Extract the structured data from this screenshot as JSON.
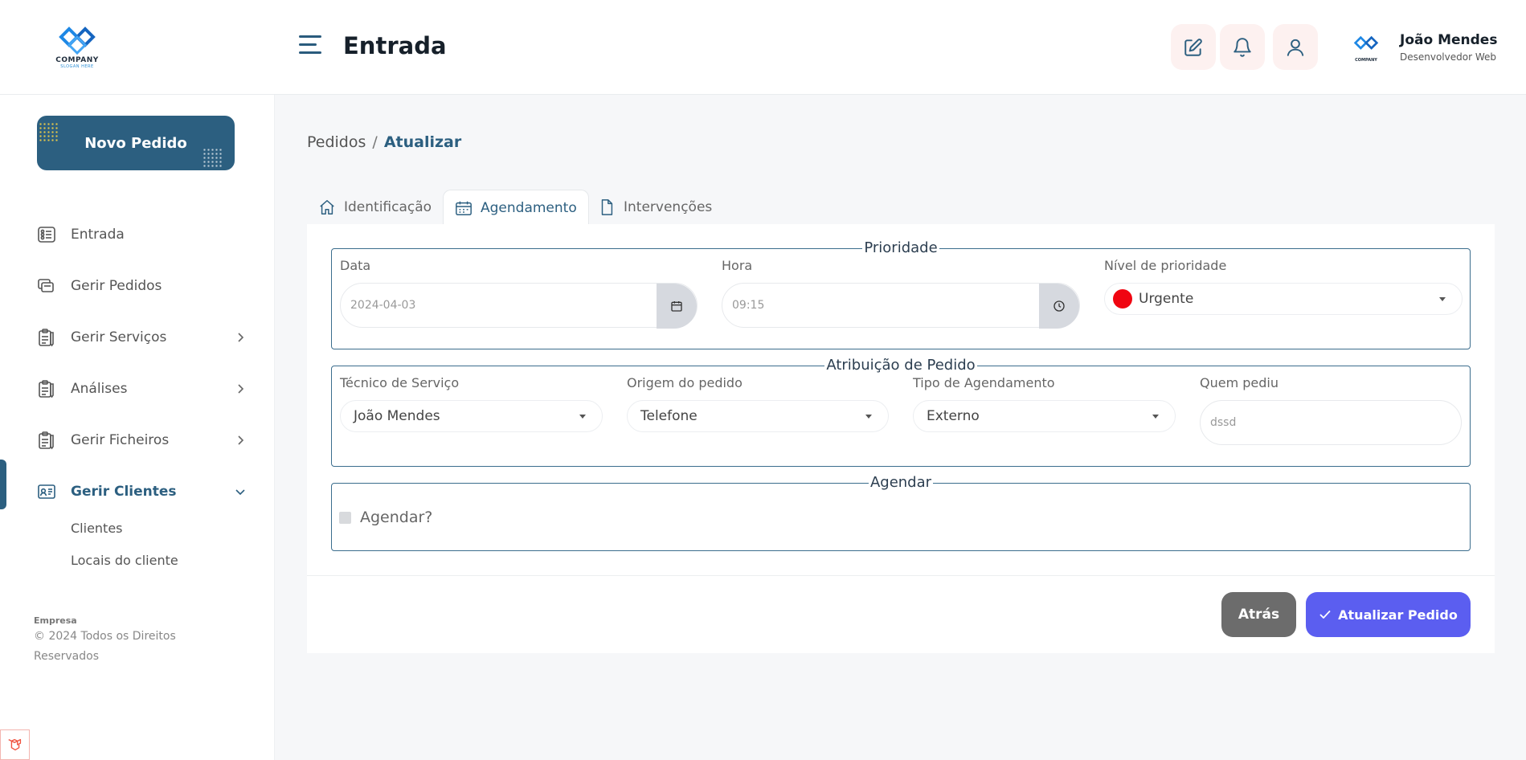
{
  "brand": {
    "name": "COMPANY",
    "slogan": "SLOGAN HERE"
  },
  "header": {
    "title": "Entrada",
    "buttons": [
      {
        "icon": "edit-icon"
      },
      {
        "icon": "bell-icon"
      },
      {
        "icon": "user-icon"
      }
    ],
    "profile": {
      "logo_text": "COMPANY",
      "name": "João Mendes",
      "role": "Desenvolvedor Web"
    }
  },
  "sidebar": {
    "new_order_label": "Novo Pedido",
    "items": [
      {
        "label": "Entrada",
        "icon": "dashboard-icon",
        "has_chevron": false
      },
      {
        "label": "Gerir Pedidos",
        "icon": "stack-icon",
        "has_chevron": false
      },
      {
        "label": "Gerir Serviços",
        "icon": "clipboard-icon",
        "has_chevron": true
      },
      {
        "label": "Análises",
        "icon": "clipboard-icon",
        "has_chevron": true
      },
      {
        "label": "Gerir Ficheiros",
        "icon": "clipboard-icon",
        "has_chevron": true
      },
      {
        "label": "Gerir Clientes",
        "icon": "id-card-icon",
        "has_chevron": true,
        "active": true
      }
    ],
    "subitems": [
      "Clientes",
      "Locais do cliente"
    ],
    "footer_company": "Empresa",
    "footer_copy": "© 2024 Todos os Direitos Reservados"
  },
  "breadcrumb": {
    "parent": "Pedidos",
    "separator": "/",
    "current": "Atualizar"
  },
  "tabs": [
    {
      "label": "Identificação",
      "icon": "home-icon"
    },
    {
      "label": "Agendamento",
      "icon": "calendar-icon",
      "active": true
    },
    {
      "label": "Intervenções",
      "icon": "file-icon"
    }
  ],
  "priority": {
    "legend": "Prioridade",
    "date_label": "Data",
    "date_value": "2024-04-03",
    "time_label": "Hora",
    "time_value": "09:15",
    "level_label": "Nível de prioridade",
    "level_value": "Urgente",
    "level_color": "#f00511"
  },
  "assignment": {
    "legend": "Atribuição de Pedido",
    "technician_label": "Técnico de Serviço",
    "technician_value": "João Mendes",
    "origin_label": "Origem do pedido",
    "origin_value": "Telefone",
    "type_label": "Tipo de Agendamento",
    "type_value": "Externo",
    "requester_label": "Quem pediu",
    "requester_value": "dssd"
  },
  "schedule": {
    "legend": "Agendar",
    "checkbox_label": "Agendar?",
    "checked": false
  },
  "actions": {
    "back_label": "Atrás",
    "update_label": "Atualizar Pedido"
  },
  "colors": {
    "primary": "#2c5f80",
    "accent": "#5b5ef0",
    "back": "#6c6c6c",
    "urgent": "#f00511"
  }
}
